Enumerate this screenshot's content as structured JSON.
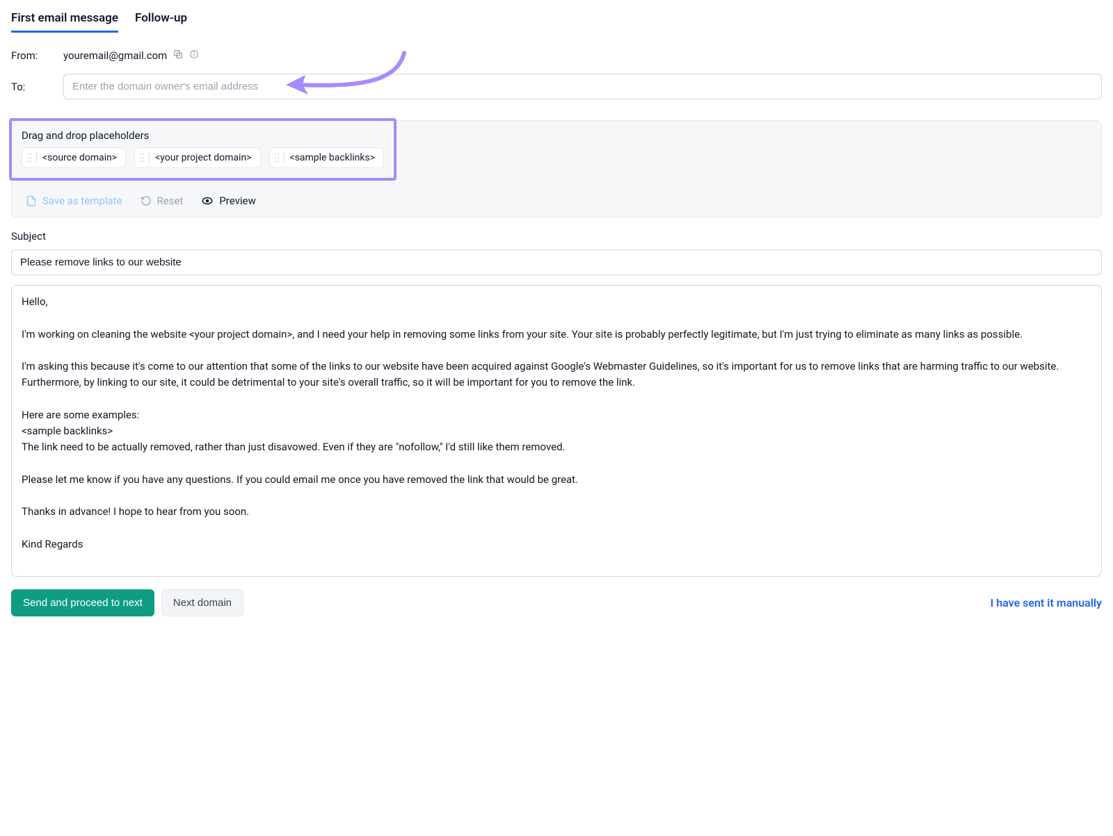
{
  "tabs": {
    "first": "First email message",
    "followup": "Follow-up"
  },
  "from": {
    "label": "From:",
    "value": "youremail@gmail.com"
  },
  "to": {
    "label": "To:",
    "placeholder": "Enter the domain owner's email address"
  },
  "drag": {
    "title": "Drag and drop placeholders",
    "chips": [
      "<source domain>",
      "<your project domain>",
      "<sample backlinks>"
    ]
  },
  "toolbar": {
    "save": "Save as template",
    "reset": "Reset",
    "preview": "Preview"
  },
  "subject": {
    "label": "Subject",
    "value": "Please remove links to our website"
  },
  "body": "Hello,\n\nI'm working on cleaning the website <your project domain>, and I need your help in removing some links from your site. Your site is probably perfectly legitimate, but I'm just trying to eliminate as many links as possible.\n\nI'm asking this because it's come to our attention that some of the links to our website have been acquired against Google's Webmaster Guidelines, so it's important for us to remove links that are harming traffic to our website. Furthermore, by linking to our site, it could be detrimental to your site's overall traffic, so it will be important for you to remove the link.\n\nHere are some examples:\n<sample backlinks>\nThe link need to be actually removed, rather than just disavowed. Even if they are \"nofollow,\" I'd still like them removed.\n\nPlease let me know if you have any questions. If you could email me once you have removed the link that would be great.\n\nThanks in advance! I hope to hear from you soon.\n\nKind Regards",
  "footer": {
    "send": "Send and proceed to next",
    "next": "Next domain",
    "manual": "I have sent it manually"
  }
}
